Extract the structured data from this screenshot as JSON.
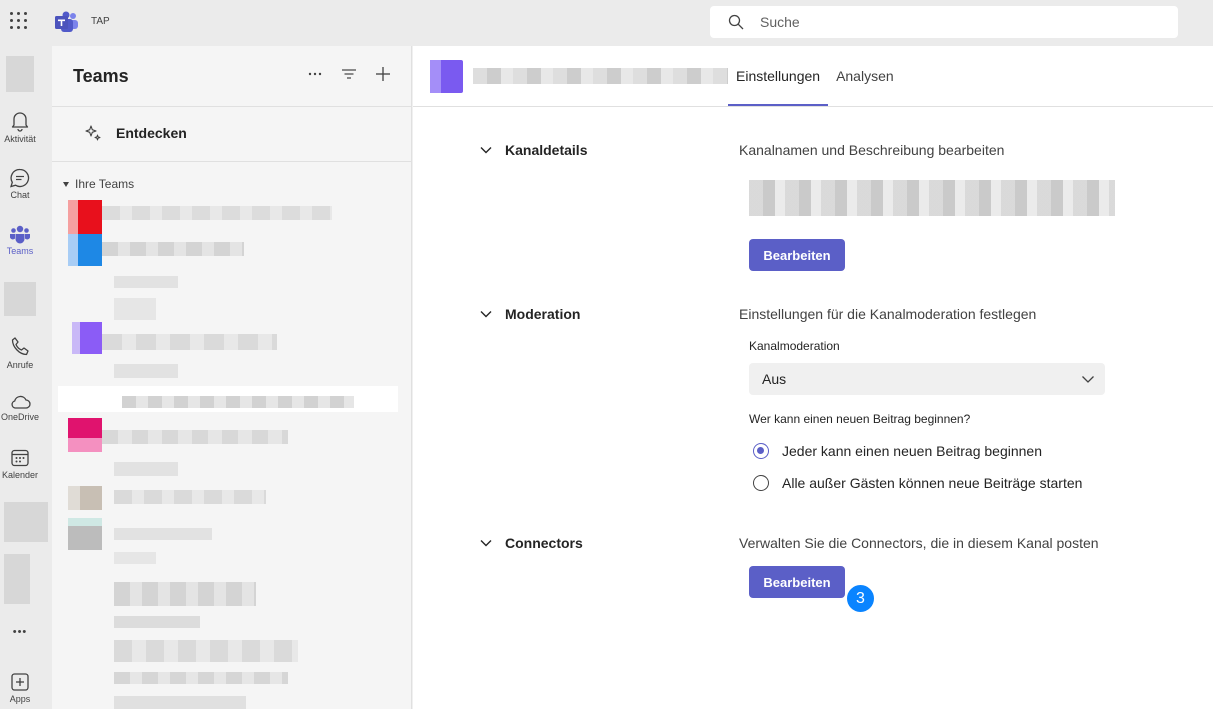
{
  "topbar": {
    "org_label": "TAP",
    "search_placeholder": "Suche"
  },
  "rail": {
    "items": [
      {
        "label": "Aktivität",
        "icon": "bell-icon"
      },
      {
        "label": "Chat",
        "icon": "chat-icon"
      },
      {
        "label": "Teams",
        "icon": "teams-icon",
        "active": true
      },
      {
        "label": "Anrufe",
        "icon": "phone-icon"
      },
      {
        "label": "OneDrive",
        "icon": "cloud-icon"
      },
      {
        "label": "Kalender",
        "icon": "calendar-icon"
      },
      {
        "label": "Apps",
        "icon": "add-app-icon"
      }
    ],
    "more_label": "•••"
  },
  "panel": {
    "title": "Teams",
    "discover_label": "Entdecken",
    "section_label": "Ihre Teams"
  },
  "main": {
    "tabs": [
      {
        "label": "Einstellungen",
        "active": true
      },
      {
        "label": "Analysen",
        "active": false
      }
    ],
    "sections": {
      "details": {
        "title": "Kanaldetails",
        "description": "Kanalnamen und Beschreibung bearbeiten",
        "button": "Bearbeiten"
      },
      "moderation": {
        "title": "Moderation",
        "description": "Einstellungen für die Kanalmoderation festlegen",
        "select_label": "Kanalmoderation",
        "select_value": "Aus",
        "question": "Wer kann einen neuen Beitrag beginnen?",
        "options": [
          {
            "label": "Jeder kann einen neuen Beitrag beginnen",
            "checked": true
          },
          {
            "label": "Alle außer Gästen können neue Beiträge starten",
            "checked": false
          }
        ]
      },
      "connectors": {
        "title": "Connectors",
        "description": "Verwalten Sie die Connectors, die in diesem Kanal posten",
        "button": "Bearbeiten",
        "step_badge": "3"
      }
    }
  },
  "colors": {
    "accent": "#5b5fc7",
    "badge": "#0a84ff"
  }
}
